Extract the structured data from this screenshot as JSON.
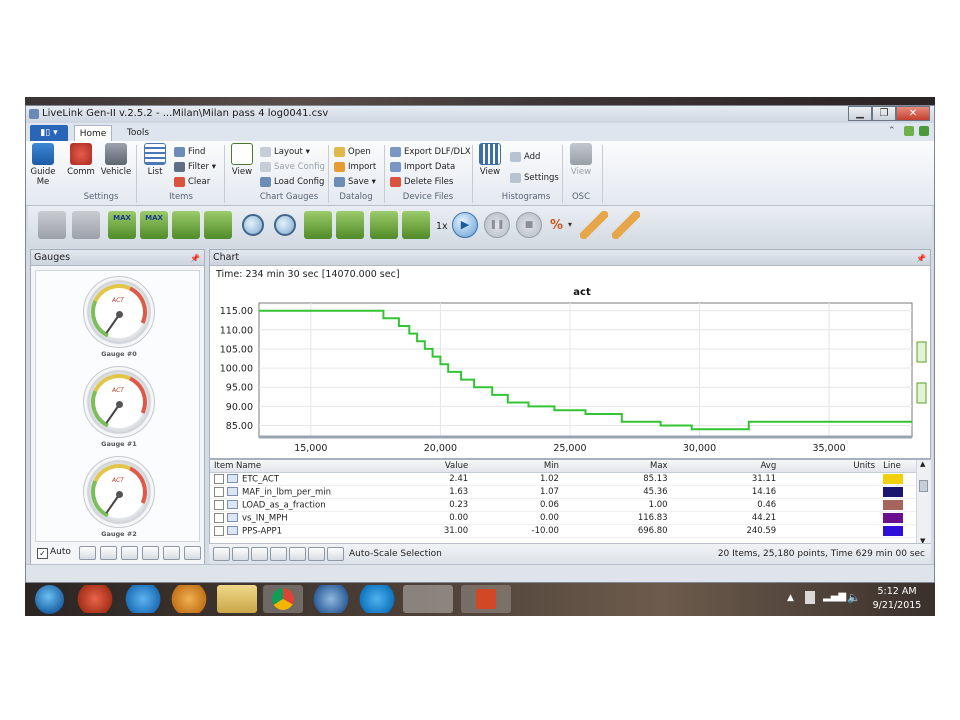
{
  "window": {
    "title": "LiveLink Gen-II  v.2.5.2 - ...Milan\\Milan pass 4 log0041.csv"
  },
  "ribbon": {
    "app_menu_label": "▮▯ ▾",
    "tabs": [
      "Home",
      "Tools"
    ],
    "groups": {
      "settings": {
        "label": "Settings",
        "guide": "Guide\nMe",
        "comm": "Comm",
        "vehicle": "Vehicle"
      },
      "items": {
        "label": "Items",
        "list": "List",
        "find": "Find",
        "filter": "Filter ▾",
        "clear": "Clear"
      },
      "chart_gauges": {
        "label": "Chart Gauges",
        "view": "View",
        "layout": "Layout",
        "save_config": "Save Config",
        "load_config": "Load Config"
      },
      "datalog": {
        "label": "Datalog",
        "open": "Open",
        "import": "Import",
        "save": "Save ▾"
      },
      "device_files": {
        "label": "Device Files",
        "export": "Export DLF/DLX",
        "import_data": "Import Data",
        "delete_files": "Delete Files"
      },
      "histograms": {
        "label": "Histograms",
        "view": "View",
        "add": "Add",
        "settings": "Settings"
      },
      "osc": {
        "label": "OSC",
        "view": "View"
      }
    }
  },
  "toolbar": {
    "speed_label": "1x",
    "max_label": "MAX"
  },
  "gauges_panel": {
    "title": "Gauges",
    "gauge_act": "ACT",
    "gauges": [
      "Gauge #0",
      "Gauge #1",
      "Gauge #2"
    ],
    "auto_label": "Auto"
  },
  "chart_panel": {
    "title": "Chart",
    "time_label": "Time: 234 min 30 sec [14070.000 sec]"
  },
  "chart_data": {
    "type": "line",
    "title": "act",
    "xlim": [
      13000,
      38200
    ],
    "ylim": [
      82,
      117
    ],
    "x_ticks": [
      15000,
      20000,
      25000,
      30000,
      35000
    ],
    "x_tick_labels": [
      "15,000",
      "20,000",
      "25,000",
      "30,000",
      "35,000"
    ],
    "y_ticks": [
      85,
      90,
      95,
      100,
      105,
      110,
      115
    ],
    "y_tick_labels": [
      "85.00",
      "90.00",
      "95.00",
      "100.00",
      "105.00",
      "110.00",
      "115.00"
    ],
    "grid": true,
    "line_color": "#33c433",
    "series": [
      {
        "x": [
          13000,
          17800,
          17800,
          18400,
          18400,
          18800,
          18800,
          19100,
          19100,
          19400,
          19400,
          19700,
          19700,
          20000,
          20000,
          20300,
          20300,
          20800,
          20800,
          21300,
          21300,
          22000,
          22000,
          22600,
          22600,
          23400,
          23400,
          24400,
          24400,
          25600,
          25600,
          27000,
          27000,
          28500,
          28500,
          29700,
          29700,
          31900,
          31900,
          38200
        ],
        "y": [
          115,
          115,
          113,
          113,
          111,
          111,
          109,
          109,
          107,
          107,
          105,
          105,
          103,
          103,
          101,
          101,
          99,
          99,
          97,
          97,
          95,
          95,
          93,
          93,
          91,
          91,
          90,
          90,
          89,
          89,
          88,
          88,
          86,
          86,
          85,
          85,
          84,
          84,
          86,
          86
        ]
      }
    ]
  },
  "items_table": {
    "columns": [
      "Item Name",
      "Value",
      "Min",
      "Max",
      "Avg",
      "Units",
      "Line"
    ],
    "rows": [
      {
        "name": "ETC_ACT",
        "value": "2.41",
        "min": "1.02",
        "max": "85.13",
        "avg": "31.11",
        "color": "#f2d10c"
      },
      {
        "name": "MAF_in_lbm_per_min",
        "value": "1.63",
        "min": "1.07",
        "max": "45.36",
        "avg": "14.16",
        "color": "#1b1670"
      },
      {
        "name": "LOAD_as_a_fraction",
        "value": "0.23",
        "min": "0.06",
        "max": "1.00",
        "avg": "0.46",
        "color": "#a5655a"
      },
      {
        "name": "vs_IN_MPH",
        "value": "0.00",
        "min": "0.00",
        "max": "116.83",
        "avg": "44.21",
        "color": "#6a0f8e"
      },
      {
        "name": "PPS-APP1",
        "value": "31.00",
        "min": "-10.00",
        "max": "696.80",
        "avg": "240.59",
        "color": "#3010d8"
      }
    ]
  },
  "bottom_bar": {
    "autoscale_label": "Auto-Scale Selection",
    "summary": "20 Items, 25,180 points, Time 629 min 00 sec"
  },
  "taskbar": {
    "time": "5:12 AM",
    "date": "9/21/2015"
  }
}
